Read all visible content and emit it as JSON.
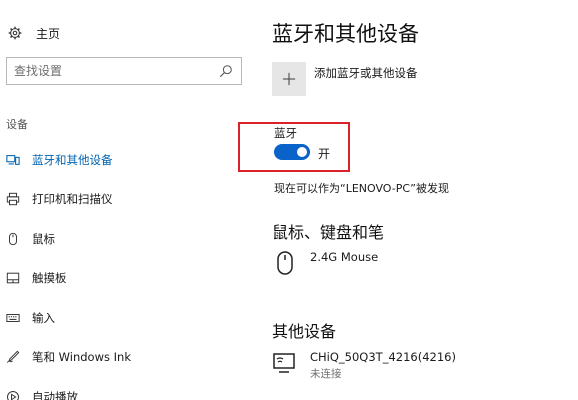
{
  "sidebar": {
    "home_label": "主页",
    "search_placeholder": "查找设置",
    "section_label": "设备",
    "items": [
      {
        "label": "蓝牙和其他设备",
        "icon": "bluetooth-devices-icon",
        "active": true
      },
      {
        "label": "打印机和扫描仪",
        "icon": "printer-icon",
        "active": false
      },
      {
        "label": "鼠标",
        "icon": "mouse-icon",
        "active": false
      },
      {
        "label": "触摸板",
        "icon": "touchpad-icon",
        "active": false
      },
      {
        "label": "输入",
        "icon": "keyboard-icon",
        "active": false
      },
      {
        "label": "笔和 Windows Ink",
        "icon": "pen-icon",
        "active": false
      },
      {
        "label": "自动播放",
        "icon": "autoplay-icon",
        "active": false
      }
    ]
  },
  "main": {
    "title": "蓝牙和其他设备",
    "add_device_label": "添加蓝牙或其他设备",
    "bluetooth": {
      "label": "蓝牙",
      "toggle_state": "开",
      "on": true,
      "discoverable_text": "现在可以作为“LENOVO-PC”被发现"
    },
    "mouse_section": {
      "title": "鼠标、键盘和笔",
      "devices": [
        {
          "name": "2.4G Mouse",
          "icon": "mouse-icon"
        }
      ]
    },
    "other_section": {
      "title": "其他设备",
      "devices": [
        {
          "name": "CHiQ_50Q3T_4216(4216)",
          "status": "未连接",
          "icon": "display-icon"
        }
      ]
    }
  },
  "colors": {
    "accent": "#0063b1",
    "toggle_on": "#0a63c9",
    "highlight_box": "#d9222a"
  }
}
